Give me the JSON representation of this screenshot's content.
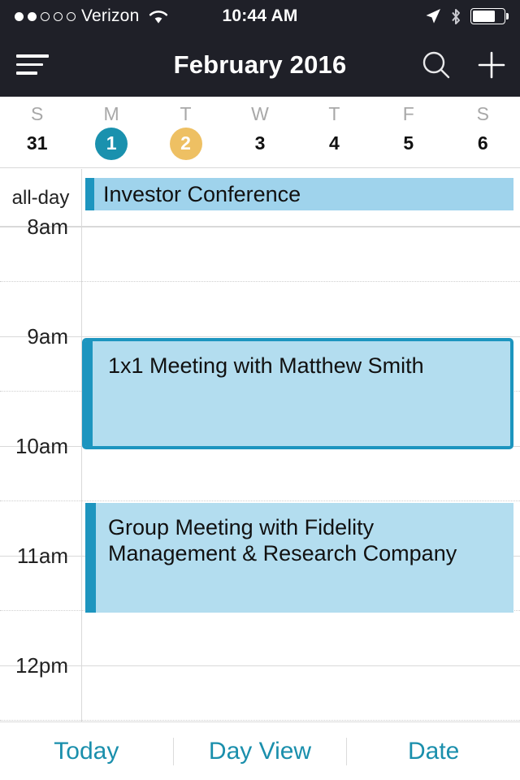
{
  "status_bar": {
    "signal_dots_filled": 2,
    "signal_dots_total": 5,
    "carrier": "Verizon",
    "wifi_icon": "wifi-icon",
    "time": "10:44 AM",
    "location_icon": "location-arrow-icon",
    "bluetooth_icon": "bluetooth-icon",
    "battery_icon": "battery-icon",
    "battery_percent": 75
  },
  "nav_bar": {
    "menu_icon": "hamburger-menu-icon",
    "title": "February 2016",
    "search_icon": "search-icon",
    "add_icon": "plus-icon",
    "background_color": "#1f2028"
  },
  "week_strip": {
    "days": [
      {
        "dow": "S",
        "date": "31",
        "selected": "none"
      },
      {
        "dow": "M",
        "date": "1",
        "selected": "teal"
      },
      {
        "dow": "T",
        "date": "2",
        "selected": "gold"
      },
      {
        "dow": "W",
        "date": "3",
        "selected": "none"
      },
      {
        "dow": "T",
        "date": "4",
        "selected": "none"
      },
      {
        "dow": "F",
        "date": "5",
        "selected": "none"
      },
      {
        "dow": "S",
        "date": "6",
        "selected": "none"
      }
    ],
    "today_color": "#1a91ae",
    "selected_color": "#eec063"
  },
  "calendar": {
    "all_day_label": "all-day",
    "hours": [
      {
        "label": "8am"
      },
      {
        "label": "9am"
      },
      {
        "label": "10am"
      },
      {
        "label": "11am"
      },
      {
        "label": "12pm"
      }
    ],
    "event_fill_color": "#b3ddef",
    "event_accent_color": "#1d95bf",
    "all_day_fill_color": "#9fd3ec",
    "events": [
      {
        "title": "Investor Conference",
        "type": "all-day",
        "selected": false
      },
      {
        "title": "1x1 Meeting with Matthew Smith",
        "type": "timed",
        "start": "9am",
        "end": "10am",
        "selected": true
      },
      {
        "title": "Group Meeting with Fidelity Management & Research Company",
        "type": "timed",
        "start": "10:30am",
        "end": "11:30am",
        "selected": false
      }
    ]
  },
  "toolbar": {
    "today_label": "Today",
    "day_view_label": "Day View",
    "date_label": "Date",
    "tint_color": "#1a8fac"
  }
}
